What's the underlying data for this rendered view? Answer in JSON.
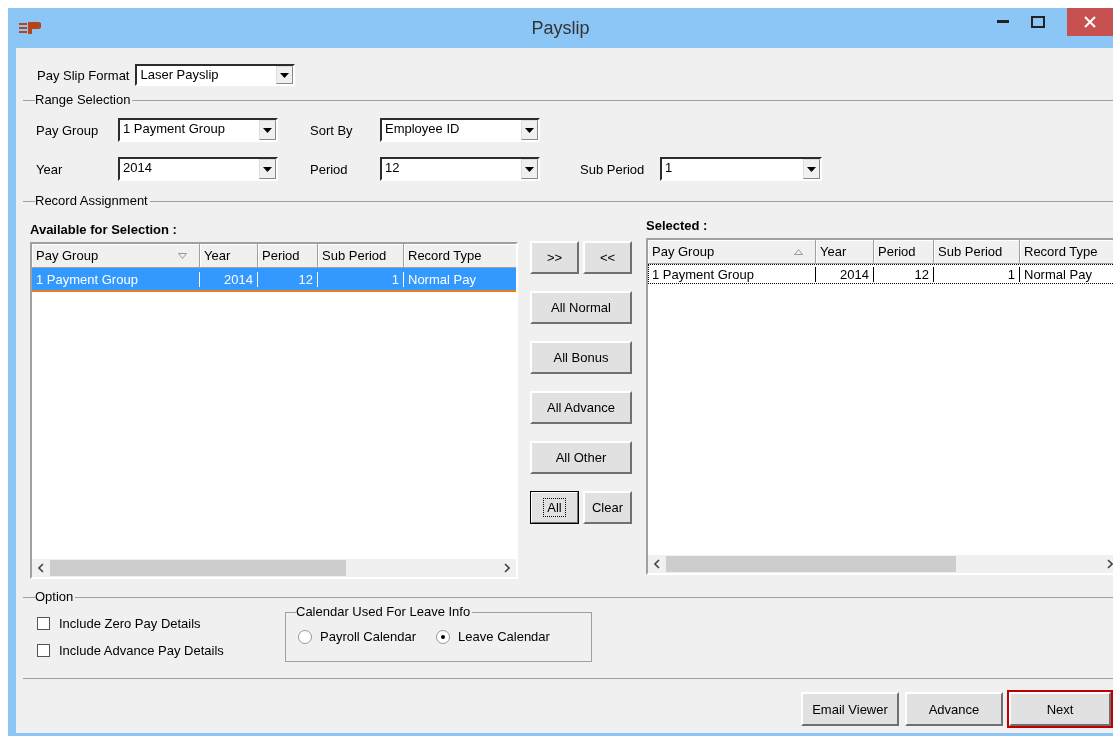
{
  "window": {
    "title": "Payslip"
  },
  "format": {
    "label": "Pay Slip Format",
    "value": "Laser Payslip"
  },
  "range_selection": {
    "title": "Range Selection",
    "fields": [
      {
        "label": "Pay Group",
        "value": "1 Payment Group"
      },
      {
        "label": "Sort By",
        "value": "Employee ID"
      },
      {
        "label": "Year",
        "value": "2014"
      },
      {
        "label": "Period",
        "value": "12"
      },
      {
        "label": "Sub Period",
        "value": "1"
      }
    ]
  },
  "record_assignment": {
    "title": "Record Assignment",
    "available": {
      "title": "Available for Selection :",
      "columns": [
        {
          "label": "Pay Group",
          "sorted": true,
          "ascending": false
        },
        {
          "label": "Year"
        },
        {
          "label": "Period"
        },
        {
          "label": "Sub Period"
        },
        {
          "label": "Record Type"
        }
      ],
      "rows": [
        {
          "cells": [
            "1 Payment Group",
            "2014",
            "12",
            "1",
            "Normal Pay"
          ],
          "selected": true
        }
      ]
    },
    "move_buttons": [
      ">>",
      "<<"
    ],
    "buttons": [
      "All Normal",
      "All Bonus",
      "All Advance",
      "All Other"
    ],
    "bottom_buttons": [
      {
        "label": "All",
        "focused": true
      },
      {
        "label": "Clear",
        "focused": false
      }
    ],
    "selected": {
      "title": "Selected :",
      "columns": [
        {
          "label": "Pay Group",
          "sorted": true,
          "ascending": true
        },
        {
          "label": "Year"
        },
        {
          "label": "Period"
        },
        {
          "label": "Sub Period"
        },
        {
          "label": "Record Type"
        }
      ],
      "rows": [
        {
          "cells": [
            "1 Payment Group",
            "2014",
            "12",
            "1",
            "Normal Pay"
          ],
          "selected": false
        }
      ]
    }
  },
  "option": {
    "title": "Option",
    "checkboxes": [
      {
        "label": "Include Zero Pay Details",
        "checked": false
      },
      {
        "label": "Include Advance Pay Details",
        "checked": false
      }
    ],
    "calendar": {
      "title": "Calendar Used For Leave Info",
      "radios": [
        {
          "label": "Payroll Calendar",
          "selected": false
        },
        {
          "label": "Leave Calendar",
          "selected": true
        }
      ]
    }
  },
  "footer_buttons": [
    {
      "label": "Email Viewer",
      "highlighted": false
    },
    {
      "label": "Advance",
      "highlighted": false
    },
    {
      "label": "Next",
      "highlighted": true
    }
  ]
}
